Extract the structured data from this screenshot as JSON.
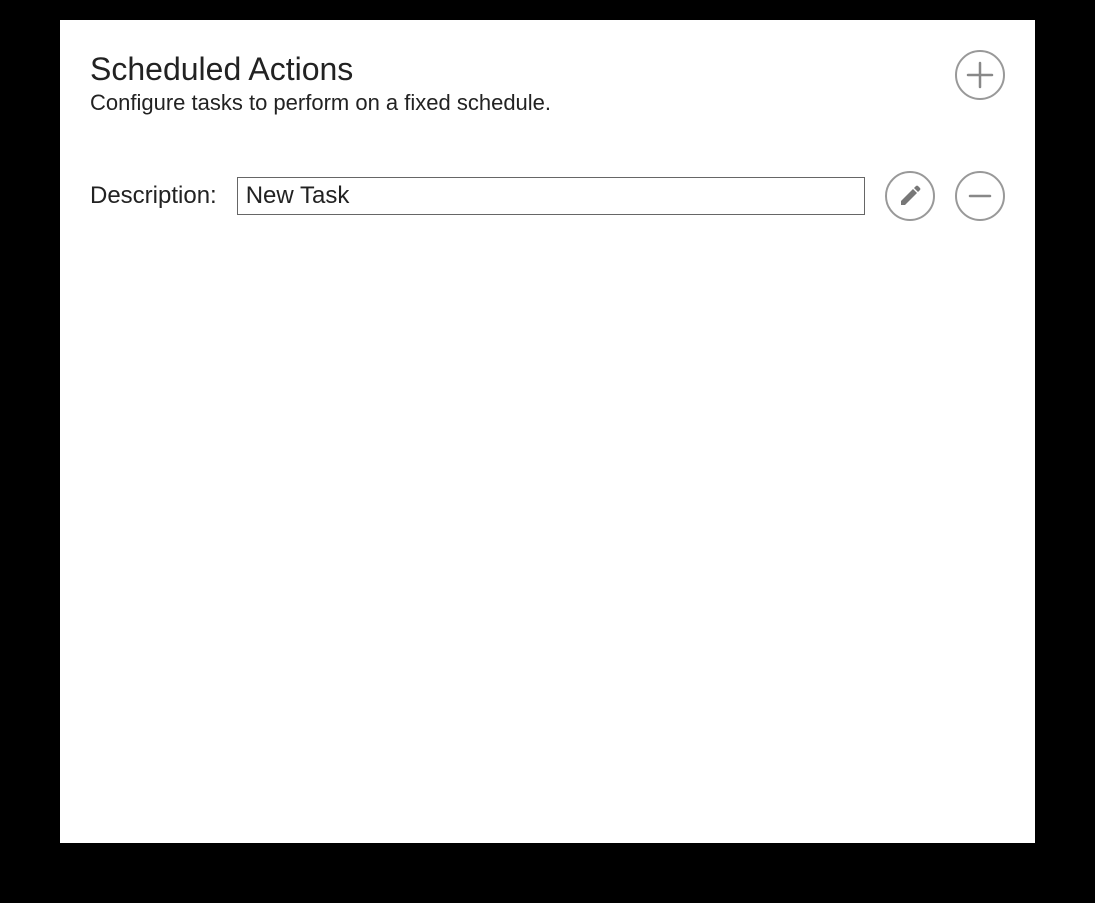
{
  "header": {
    "title": "Scheduled Actions",
    "subtitle": "Configure tasks to perform on a fixed schedule."
  },
  "tasks": [
    {
      "label": "Description:",
      "value": "New Task"
    }
  ]
}
